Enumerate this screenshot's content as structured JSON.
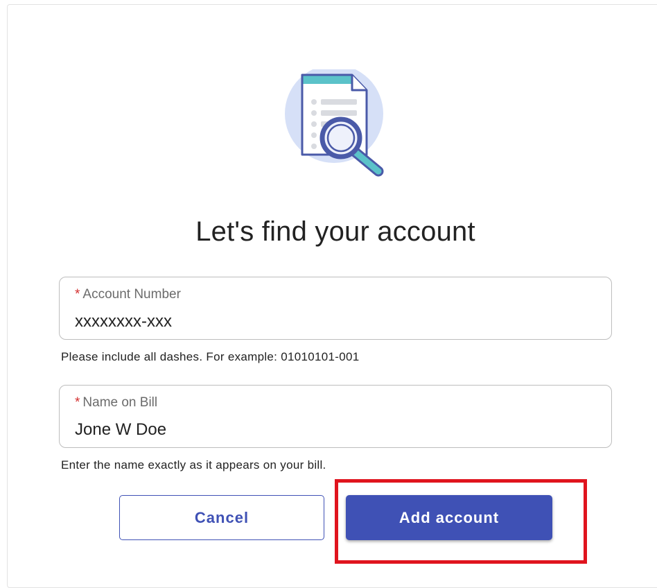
{
  "page": {
    "title": "Let's find your account"
  },
  "fields": {
    "account_number": {
      "required_mark": "*",
      "label": "Account Number",
      "value": "xxxxxxxx-xxx",
      "helper": "Please include all dashes. For example: 01010101-001"
    },
    "name_on_bill": {
      "required_mark": "*",
      "label": "Name on Bill",
      "value": "Jone W Doe",
      "helper": "Enter the name exactly as it appears on your bill."
    }
  },
  "actions": {
    "cancel_label": "Cancel",
    "add_label": "Add account"
  },
  "illustration": {
    "icon": "document-search-icon"
  },
  "colors": {
    "primary": "#3f51b5",
    "required": "#d32f2f",
    "highlight": "#e0141e",
    "illustration_circle": "#d6e0f7",
    "illustration_header": "#5bc2c9"
  }
}
